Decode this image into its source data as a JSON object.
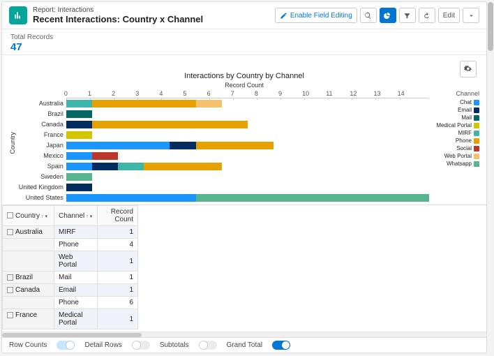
{
  "header": {
    "type": "Report: Interactions",
    "title": "Recent Interactions: Country x Channel",
    "enable_field_editing": "Enable Field Editing",
    "edit": "Edit"
  },
  "totals": {
    "label": "Total Records",
    "value": "47"
  },
  "legend_title": "Channel",
  "chart_data": {
    "type": "bar",
    "orientation": "horizontal",
    "stacked": true,
    "title": "Interactions by Country by Channel",
    "xlabel": "Record Count",
    "ylabel": "Country",
    "xlim": [
      0,
      14
    ],
    "xticks": [
      0,
      1,
      2,
      3,
      4,
      5,
      6,
      7,
      8,
      9,
      10,
      11,
      12,
      13,
      14
    ],
    "categories": [
      "Australia",
      "Brazil",
      "Canada",
      "France",
      "Japan",
      "Mexico",
      "Spain",
      "Sweden",
      "United Kingdom",
      "United States"
    ],
    "series": [
      {
        "name": "Chat",
        "color": "#1b96ff",
        "values": [
          0,
          0,
          0,
          0,
          4,
          1,
          1,
          0,
          0,
          5
        ]
      },
      {
        "name": "Email",
        "color": "#032d60",
        "values": [
          0,
          0,
          1,
          0,
          1,
          0,
          1,
          0,
          1,
          0
        ]
      },
      {
        "name": "Mail",
        "color": "#056764",
        "values": [
          0,
          1,
          0,
          0,
          0,
          0,
          0,
          0,
          0,
          0
        ]
      },
      {
        "name": "Medical Portal",
        "color": "#d1c600",
        "values": [
          0,
          0,
          0,
          1,
          0,
          0,
          0,
          0,
          0,
          0
        ]
      },
      {
        "name": "MIRF",
        "color": "#3fb7a8",
        "values": [
          1,
          0,
          0,
          0,
          0,
          0,
          1,
          0,
          0,
          0
        ]
      },
      {
        "name": "Phone",
        "color": "#e6a100",
        "values": [
          4,
          0,
          6,
          0,
          3,
          0,
          3,
          0,
          0,
          0
        ]
      },
      {
        "name": "Social",
        "color": "#ba372a",
        "values": [
          0,
          0,
          0,
          0,
          0,
          1,
          0,
          0,
          0,
          0
        ]
      },
      {
        "name": "Web Portal",
        "color": "#f5c26b",
        "values": [
          1,
          0,
          0,
          0,
          0,
          0,
          0,
          0,
          0,
          0
        ]
      },
      {
        "name": "Whatsapp",
        "color": "#56b48f",
        "values": [
          0,
          0,
          0,
          0,
          0,
          0,
          0,
          1,
          0,
          9
        ]
      }
    ]
  },
  "table": {
    "headers": {
      "country": "Country",
      "channel": "Channel",
      "rc": "Record Count"
    },
    "rows": [
      {
        "country": "Australia",
        "channel": "MIRF",
        "rc": 1,
        "stripe": true,
        "first": true
      },
      {
        "country": "",
        "channel": "Phone",
        "rc": 4
      },
      {
        "country": "",
        "channel": "Web Portal",
        "rc": 1,
        "stripe": true
      },
      {
        "country": "Brazil",
        "channel": "Mail",
        "rc": 1,
        "first": true
      },
      {
        "country": "Canada",
        "channel": "Email",
        "rc": 1,
        "stripe": true,
        "first": true
      },
      {
        "country": "",
        "channel": "Phone",
        "rc": 6
      },
      {
        "country": "France",
        "channel": "Medical Portal",
        "rc": 1,
        "stripe": true,
        "first": true
      }
    ]
  },
  "footer": {
    "row_counts": "Row Counts",
    "detail_rows": "Detail Rows",
    "subtotals": "Subtotals",
    "grand_total": "Grand Total"
  }
}
